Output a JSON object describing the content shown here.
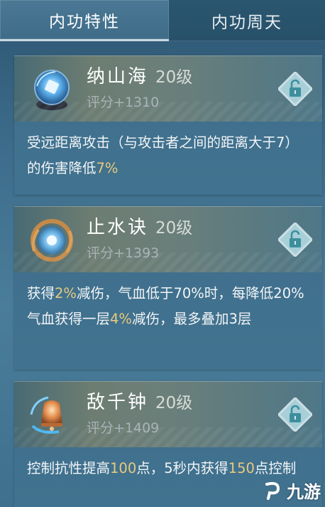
{
  "tabs": [
    {
      "label": "内功特性",
      "active": true
    },
    {
      "label": "内功周天",
      "active": false
    }
  ],
  "cards": [
    {
      "name": "纳山海",
      "level": "20级",
      "score": "评分+1310",
      "desc": [
        {
          "t": "受远距离攻击（与攻击者之间的距离大于7）的伤害降低"
        },
        {
          "t": "7%",
          "hl": true
        }
      ]
    },
    {
      "name": "止水诀",
      "level": "20级",
      "score": "评分+1393",
      "desc": [
        {
          "t": "获得"
        },
        {
          "t": "2%",
          "hl": true
        },
        {
          "t": "减伤，气血低于70%时，每降低20%气血获得一层"
        },
        {
          "t": "4%",
          "hl": true
        },
        {
          "t": "减伤，最多叠加3层"
        }
      ]
    },
    {
      "name": "敌千钟",
      "level": "20级",
      "score": "评分+1409",
      "desc": [
        {
          "t": "控制抗性提高"
        },
        {
          "t": "100",
          "hl": true
        },
        {
          "t": "点，5秒内获得"
        },
        {
          "t": "150",
          "hl": true
        },
        {
          "t": "点控制"
        }
      ]
    }
  ],
  "watermark": "九游",
  "colors": {
    "highlight": "#e9c97f",
    "text": "#f2f5f7",
    "score": "#a8b3b6"
  },
  "icons": {
    "lock": "lock-open-icon",
    "watermark": "jiuyou-logo-icon"
  }
}
